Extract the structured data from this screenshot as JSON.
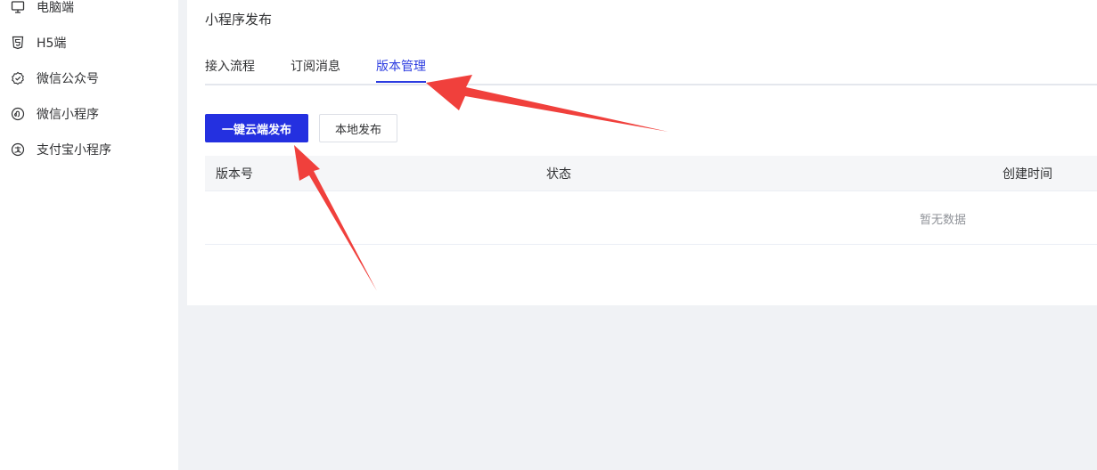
{
  "sidebar": {
    "items": [
      {
        "label": "电脑端",
        "icon": "monitor-icon"
      },
      {
        "label": "H5端",
        "icon": "html5-icon"
      },
      {
        "label": "微信公众号",
        "icon": "wechat-official-icon"
      },
      {
        "label": "微信小程序",
        "icon": "wechat-miniprogram-icon"
      },
      {
        "label": "支付宝小程序",
        "icon": "alipay-miniprogram-icon"
      }
    ]
  },
  "main": {
    "title": "小程序发布",
    "tabs": [
      {
        "label": "接入流程",
        "active": false
      },
      {
        "label": "订阅消息",
        "active": false
      },
      {
        "label": "版本管理",
        "active": true
      }
    ],
    "actions": {
      "cloud_publish_label": "一键云端发布",
      "local_publish_label": "本地发布"
    },
    "table": {
      "columns": [
        "版本号",
        "状态",
        "创建时间"
      ],
      "rows": [],
      "empty_text": "暂无数据"
    }
  },
  "colors": {
    "accent": "#2b3be0",
    "annotation_arrow": "#f0403c"
  }
}
